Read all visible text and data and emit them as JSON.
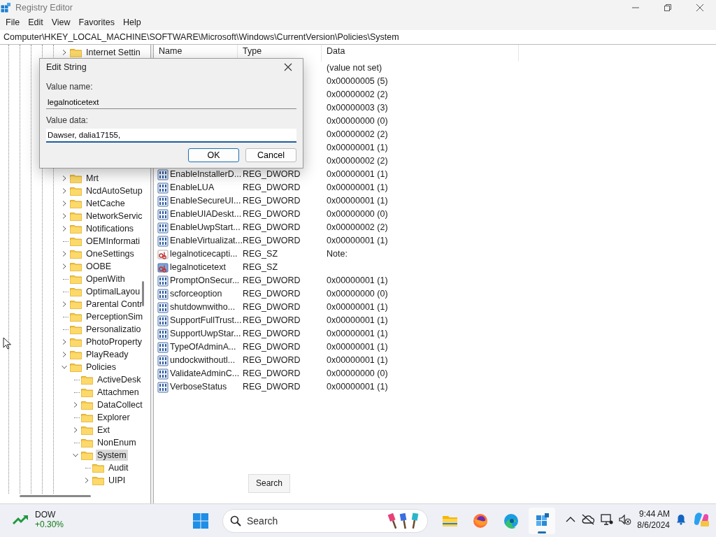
{
  "window": {
    "title": "Registry Editor"
  },
  "menu": [
    "File",
    "Edit",
    "View",
    "Favorites",
    "Help"
  ],
  "address": "Computer\\HKEY_LOCAL_MACHINE\\SOFTWARE\\Microsoft\\Windows\\CurrentVersion\\Policies\\System",
  "tree_top": [
    {
      "label": "Internet Settin",
      "expanded": false,
      "selected": false
    }
  ],
  "tree": [
    {
      "label": "Mrt",
      "expanded": false,
      "selected": false
    },
    {
      "label": "NcdAutoSetup",
      "expanded": false,
      "selected": false
    },
    {
      "label": "NetCache",
      "expanded": false,
      "selected": false
    },
    {
      "label": "NetworkServic",
      "expanded": false,
      "selected": false
    },
    {
      "label": "Notifications",
      "expanded": false,
      "selected": false
    },
    {
      "label": "OEMInformati",
      "selected": false
    },
    {
      "label": "OneSettings",
      "expanded": false,
      "selected": false
    },
    {
      "label": "OOBE",
      "expanded": false,
      "selected": false
    },
    {
      "label": "OpenWith",
      "selected": false
    },
    {
      "label": "OptimalLayou",
      "selected": false
    },
    {
      "label": "Parental Contr",
      "expanded": false,
      "selected": false
    },
    {
      "label": "PerceptionSim",
      "selected": false
    },
    {
      "label": "Personalizatio",
      "selected": false
    },
    {
      "label": "PhotoProperty",
      "expanded": false,
      "selected": false
    },
    {
      "label": "PlayReady",
      "expanded": false,
      "selected": false
    },
    {
      "label": "Policies",
      "expanded": true,
      "selected": false,
      "children": [
        {
          "label": "ActiveDesk",
          "selected": false
        },
        {
          "label": "Attachmen",
          "selected": false
        },
        {
          "label": "DataCollect",
          "expanded": false,
          "selected": false
        },
        {
          "label": "Explorer",
          "selected": false
        },
        {
          "label": "Ext",
          "expanded": false,
          "selected": false
        },
        {
          "label": "NonEnum",
          "selected": false
        },
        {
          "label": "System",
          "expanded": true,
          "selected": true,
          "children": [
            {
              "label": "Audit",
              "selected": false
            },
            {
              "label": "UIPI",
              "expanded": false,
              "selected": false
            }
          ]
        }
      ]
    }
  ],
  "columns": [
    "Name",
    "Type",
    "Data"
  ],
  "rows": [
    {
      "data": "(value not set)"
    },
    {
      "data": "0x00000005 (5)"
    },
    {
      "data": "0x00000002 (2)"
    },
    {
      "data": "0x00000003 (3)"
    },
    {
      "data": "0x00000000 (0)"
    },
    {
      "data": "0x00000002 (2)"
    },
    {
      "data": "0x00000001 (1)"
    },
    {
      "data": "0x00000002 (2)"
    },
    {
      "name": "EnableInstallerD...",
      "type": "REG_DWORD",
      "data": "0x00000001 (1)",
      "kind": "binary",
      "selected": false
    },
    {
      "name": "EnableLUA",
      "type": "REG_DWORD",
      "data": "0x00000001 (1)",
      "kind": "binary",
      "selected": false
    },
    {
      "name": "EnableSecureUI...",
      "type": "REG_DWORD",
      "data": "0x00000001 (1)",
      "kind": "binary",
      "selected": false
    },
    {
      "name": "EnableUIADeskt...",
      "type": "REG_DWORD",
      "data": "0x00000000 (0)",
      "kind": "binary",
      "selected": false
    },
    {
      "name": "EnableUwpStart...",
      "type": "REG_DWORD",
      "data": "0x00000002 (2)",
      "kind": "binary",
      "selected": false
    },
    {
      "name": "EnableVirtualizat...",
      "type": "REG_DWORD",
      "data": "0x00000001 (1)",
      "kind": "binary",
      "selected": false
    },
    {
      "name": "legalnoticecapti...",
      "type": "REG_SZ",
      "data": "Note:",
      "kind": "string",
      "selected": false
    },
    {
      "name": "legalnoticetext",
      "type": "REG_SZ",
      "kind": "string",
      "selected": true
    },
    {
      "name": "PromptOnSecur...",
      "type": "REG_DWORD",
      "data": "0x00000001 (1)",
      "kind": "binary",
      "selected": false
    },
    {
      "name": "scforceoption",
      "type": "REG_DWORD",
      "data": "0x00000000 (0)",
      "kind": "binary",
      "selected": false
    },
    {
      "name": "shutdownwitho...",
      "type": "REG_DWORD",
      "data": "0x00000001 (1)",
      "kind": "binary",
      "selected": false
    },
    {
      "name": "SupportFullTrust...",
      "type": "REG_DWORD",
      "data": "0x00000001 (1)",
      "kind": "binary",
      "selected": false
    },
    {
      "name": "SupportUwpStar...",
      "type": "REG_DWORD",
      "data": "0x00000001 (1)",
      "kind": "binary",
      "selected": false
    },
    {
      "name": "TypeOfAdminA...",
      "type": "REG_DWORD",
      "data": "0x00000001 (1)",
      "kind": "binary",
      "selected": false
    },
    {
      "name": "undockwithoutl...",
      "type": "REG_DWORD",
      "data": "0x00000001 (1)",
      "kind": "binary",
      "selected": false
    },
    {
      "name": "ValidateAdminC...",
      "type": "REG_DWORD",
      "data": "0x00000000 (0)",
      "kind": "binary",
      "selected": false
    },
    {
      "name": "VerboseStatus",
      "type": "REG_DWORD",
      "data": "0x00000001 (1)",
      "kind": "binary",
      "selected": false
    }
  ],
  "dialog": {
    "title": "Edit String",
    "name_label": "Value name:",
    "name_value": "legalnoticetext",
    "data_label": "Value data:",
    "data_value": "Dawser, dalia17155,",
    "ok": "OK",
    "cancel": "Cancel"
  },
  "tooltip": "Search",
  "taskbar": {
    "widget": {
      "name": "DOW",
      "change": "+0.30%"
    },
    "search": {
      "placeholder": "Search"
    },
    "apps": [
      {
        "kind": "folder",
        "active": false
      },
      {
        "kind": "firefox",
        "active": false
      },
      {
        "kind": "edge",
        "active": false
      },
      {
        "kind": "regedit",
        "active": true
      }
    ],
    "time": "9:44 AM",
    "date": "8/6/2024"
  }
}
